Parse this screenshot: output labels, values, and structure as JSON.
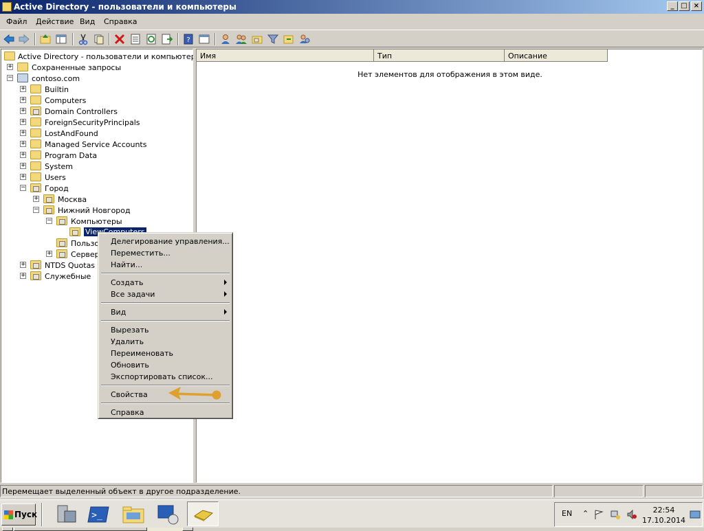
{
  "window": {
    "title": "Active Directory - пользователи и компьютеры",
    "buttons": {
      "minimize": "_",
      "maximize": "□",
      "close": "×"
    }
  },
  "menu": [
    "Файл",
    "Действие",
    "Вид",
    "Справка"
  ],
  "toolbar_icons": [
    "back-icon",
    "forward-icon",
    "up-icon",
    "show-hide-tree-icon",
    "cut-icon",
    "copy-icon",
    "delete-icon",
    "properties-icon",
    "refresh-icon",
    "export-icon",
    "help-icon",
    "console-tree-icon",
    "new-user-icon",
    "new-group-icon",
    "new-ou-icon",
    "filter-icon",
    "find-icon",
    "add-to-group-icon"
  ],
  "tree": {
    "root": "Active Directory - пользователи и компьютеры [dc",
    "items": [
      {
        "label": "Сохраненные запросы",
        "exp": "+"
      },
      {
        "label": "contoso.com",
        "exp": "−"
      },
      {
        "label": "Builtin",
        "exp": "+"
      },
      {
        "label": "Computers",
        "exp": "+"
      },
      {
        "label": "Domain Controllers",
        "exp": "+"
      },
      {
        "label": "ForeignSecurityPrincipals",
        "exp": "+"
      },
      {
        "label": "LostAndFound",
        "exp": "+"
      },
      {
        "label": "Managed Service Accounts",
        "exp": "+"
      },
      {
        "label": "Program Data",
        "exp": "+"
      },
      {
        "label": "System",
        "exp": "+"
      },
      {
        "label": "Users",
        "exp": "+"
      },
      {
        "label": "Город",
        "exp": "−"
      },
      {
        "label": "Москва",
        "exp": "+"
      },
      {
        "label": "Нижний Новгород",
        "exp": "−"
      },
      {
        "label": "Компьютеры",
        "exp": "−"
      },
      {
        "label": "ViewComputers",
        "exp": ""
      },
      {
        "label": "Пользов",
        "exp": ""
      },
      {
        "label": "Сервера",
        "exp": "+"
      },
      {
        "label": "NTDS Quotas",
        "exp": "+"
      },
      {
        "label": "Служебные",
        "exp": "+"
      }
    ]
  },
  "list": {
    "columns": [
      "Имя",
      "Тип",
      "Описание"
    ],
    "empty_message": "Нет элементов для отображения в этом виде."
  },
  "context_menu": {
    "items": [
      "Делегирование управления...",
      "Переместить...",
      "Найти...",
      "Создать",
      "Все задачи",
      "Вид",
      "Вырезать",
      "Удалить",
      "Переименовать",
      "Обновить",
      "Экспортировать список...",
      "Свойства",
      "Справка"
    ]
  },
  "annotation_arrow_color": "#e0a030",
  "status": {
    "text": "Перемещает выделенный объект в другое подразделение."
  },
  "taskbar": {
    "start_label": "Пуск",
    "language": "EN",
    "time": "22:54",
    "date": "17.10.2014"
  }
}
